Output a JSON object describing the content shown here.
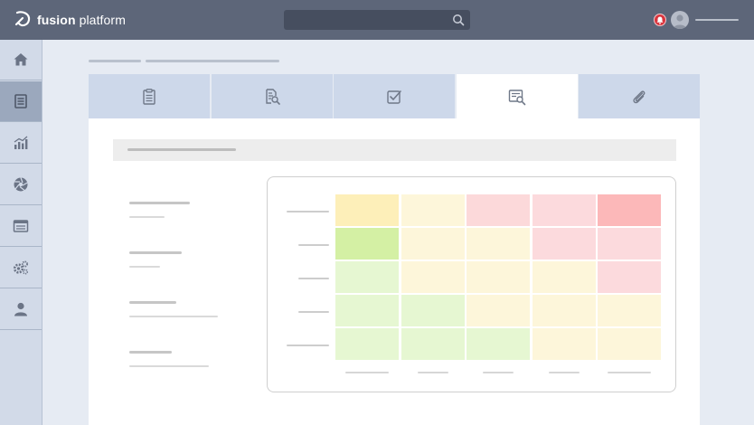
{
  "header": {
    "brand_bold": "fusion",
    "brand_light": " platform",
    "search": {
      "placeholder": ""
    },
    "icons": {
      "search": "search-icon",
      "notification": "bell-icon",
      "user": "avatar"
    },
    "colors": {
      "bar": "#5d6679",
      "notification": "#d9343d"
    }
  },
  "sidebar": {
    "items": [
      {
        "name": "home",
        "icon": "home-icon",
        "active": false
      },
      {
        "name": "documents",
        "icon": "document-icon",
        "active": true
      },
      {
        "name": "analytics",
        "icon": "chart-icon",
        "active": false
      },
      {
        "name": "aperture",
        "icon": "aperture-icon",
        "active": false
      },
      {
        "name": "browser",
        "icon": "window-icon",
        "active": false
      },
      {
        "name": "settings",
        "icon": "gears-icon",
        "active": false
      },
      {
        "name": "profile",
        "icon": "user-icon",
        "active": false
      }
    ]
  },
  "tabs": [
    {
      "name": "clipboard",
      "icon": "clipboard-icon",
      "active": false
    },
    {
      "name": "document-search",
      "icon": "document-search-icon",
      "active": false
    },
    {
      "name": "checkbox",
      "icon": "checkbox-icon",
      "active": false
    },
    {
      "name": "report-search",
      "icon": "report-search-icon",
      "active": true
    },
    {
      "name": "attachment",
      "icon": "paperclip-icon",
      "active": false
    }
  ],
  "risk_matrix": {
    "rows": 5,
    "columns": 5,
    "cell_colors": [
      [
        "#fdefb9",
        "#fdf6da",
        "#fcd9da",
        "#fcdadd",
        "#fcb8b9"
      ],
      [
        "#d4f0a4",
        "#fdf6da",
        "#fdf6da",
        "#fcdadd",
        "#fcdadd"
      ],
      [
        "#e6f7d2",
        "#fdf6da",
        "#fdf6da",
        "#fdf6da",
        "#fcdadd"
      ],
      [
        "#e6f7d2",
        "#e6f7d2",
        "#fdf6da",
        "#fdf6da",
        "#fdf6da"
      ],
      [
        "#e6f7d2",
        "#e6f7d2",
        "#e6f7d2",
        "#fdf6da",
        "#fdf6da"
      ]
    ]
  }
}
